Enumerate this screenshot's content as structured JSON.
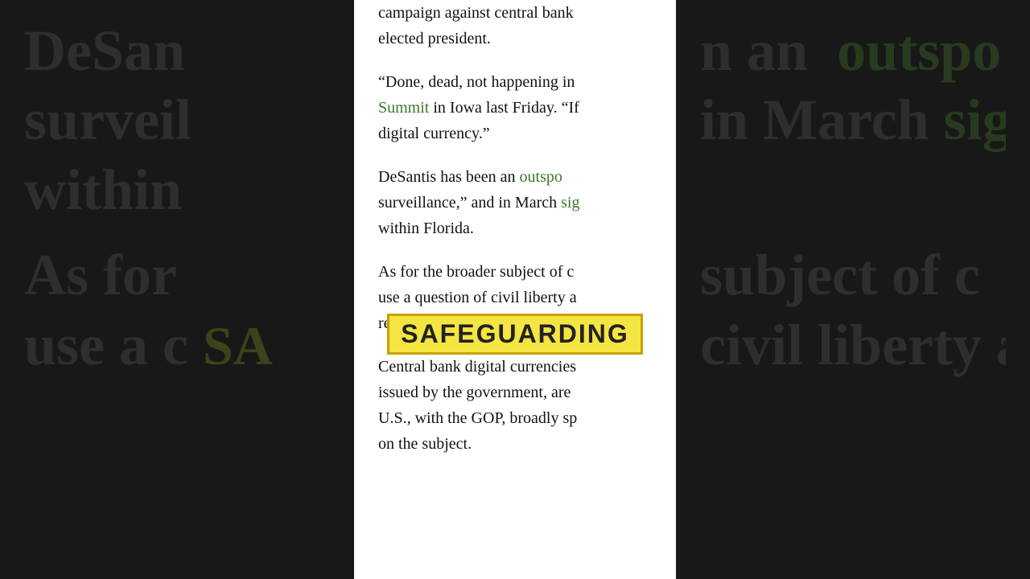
{
  "background": {
    "left_lines": [
      "DeSan",
      "surveil",
      "within",
      "As for",
      "use a c"
    ],
    "right_lines": [
      "n an  outspo",
      "in March sig",
      "",
      "subject of c",
      "civil liberty a"
    ]
  },
  "article": {
    "paragraphs": [
      {
        "id": "p1",
        "text_parts": [
          {
            "text": "campaign against central bank",
            "type": "normal"
          },
          {
            "text": "\nelected president.",
            "type": "normal"
          }
        ]
      },
      {
        "id": "p2",
        "text_parts": [
          {
            "text": "“Done, dead, not happening in",
            "type": "normal"
          },
          {
            "text": " Summit",
            "type": "green"
          },
          {
            "text": " in Iowa last Friday. “If",
            "type": "normal"
          },
          {
            "text": "\ndigital currency.”",
            "type": "normal"
          }
        ]
      },
      {
        "id": "p3",
        "text_parts": [
          {
            "text": "DeSantis has been an ",
            "type": "normal"
          },
          {
            "text": "outspo",
            "type": "green"
          },
          {
            "text": "\nsurveillance,” and in March ",
            "type": "normal"
          },
          {
            "text": "sig",
            "type": "green"
          },
          {
            "text": "\nwithin Florida.",
            "type": "normal"
          }
        ]
      },
      {
        "id": "p4",
        "text_parts": [
          {
            "text": "As for the broader subject of c",
            "type": "normal"
          },
          {
            "text": "\nuse a question of civil liberty a",
            "type": "normal"
          },
          {
            "text": "\nregime.”",
            "type": "normal"
          }
        ]
      },
      {
        "id": "p5",
        "text_parts": [
          {
            "text": "Central bank digital currencies",
            "type": "normal"
          },
          {
            "text": "\nissued by the government, are",
            "type": "normal"
          },
          {
            "text": "\nU.S., with the GOP, broadly sp",
            "type": "normal"
          },
          {
            "text": "\non the subject.",
            "type": "normal"
          }
        ]
      }
    ],
    "highlight": {
      "word": "SAFEGUARDING",
      "bg_color": "#f5e542",
      "text_color": "#222222",
      "border_color": "#c8a000"
    }
  }
}
